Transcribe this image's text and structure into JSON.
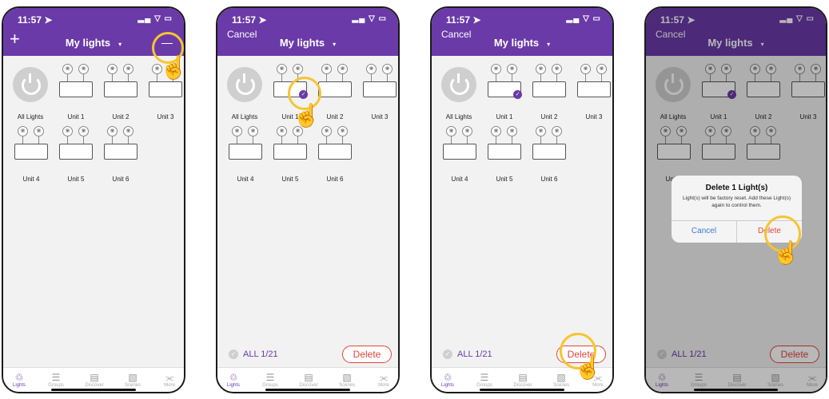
{
  "status": {
    "time": "11:57 ➤",
    "signal": "▂▄ ▽ ▭"
  },
  "header": {
    "title": "My lights",
    "caret": "▾",
    "plus": "+",
    "cancel": "Cancel"
  },
  "tiles": {
    "all_lights": "All Lights",
    "units": [
      "Unit 1",
      "Unit 2",
      "Unit 3",
      "Unit 4",
      "Unit 5",
      "Unit 6"
    ]
  },
  "bulb_glyph": "❀",
  "check_glyph": "✓",
  "selection": {
    "text": "ALL 1/21",
    "check": "✓",
    "delete": "Delete"
  },
  "tabs": [
    {
      "label": "Lights",
      "icon": "♲"
    },
    {
      "label": "Groups",
      "icon": "☰"
    },
    {
      "label": "Discover",
      "icon": "▤"
    },
    {
      "label": "Scenes",
      "icon": "▧"
    },
    {
      "label": "More",
      "icon": "⫘"
    }
  ],
  "dialog": {
    "title": "Delete 1 Light(s)",
    "message": "Light(s) will be factory reset. Add these Light(s) again to control them.",
    "cancel": "Cancel",
    "delete": "Delete"
  },
  "hand_glyph": "☝",
  "colors": {
    "accent": "#6a3aa8",
    "danger": "#e0453a",
    "highlight": "#f5c533",
    "link": "#3a78d8"
  }
}
